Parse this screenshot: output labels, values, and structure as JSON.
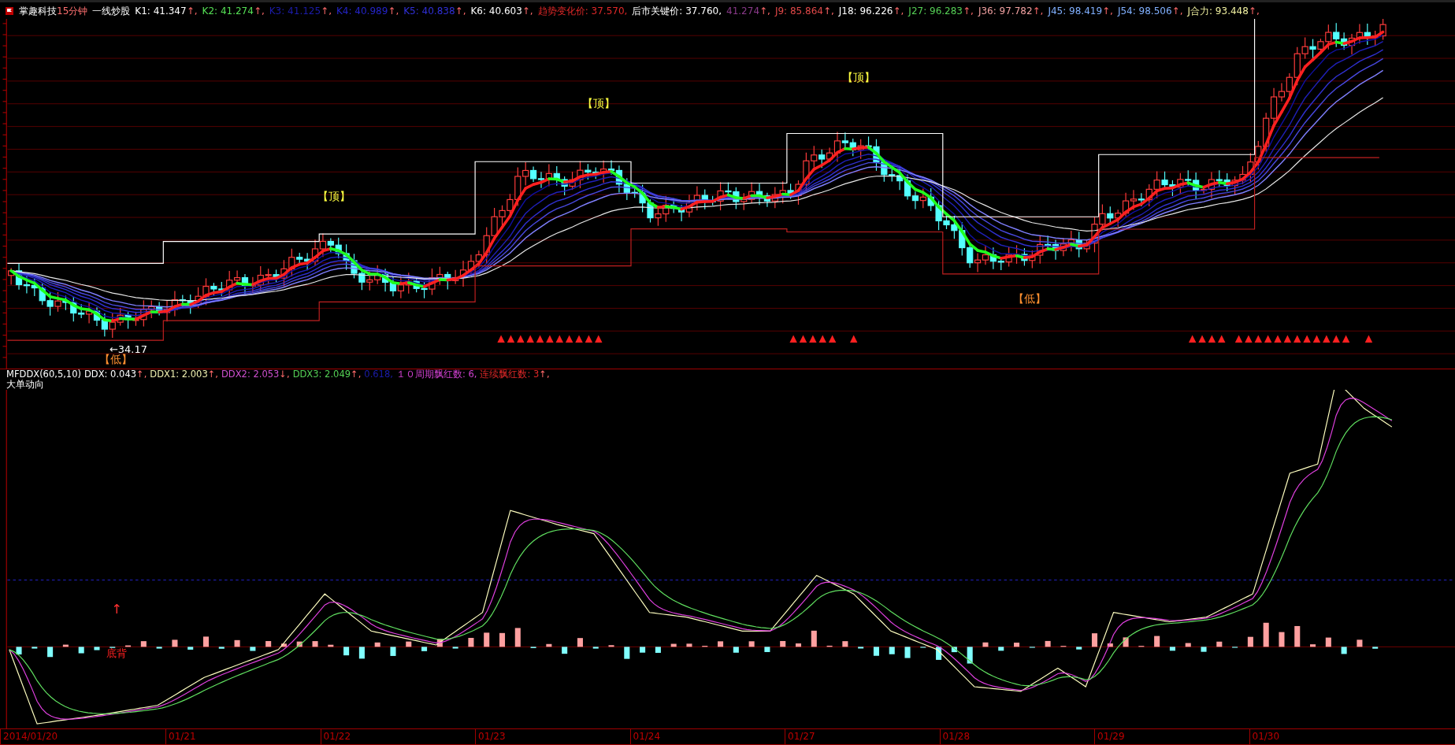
{
  "header": {
    "stock_name": "掌趣科技",
    "period": "15分钟",
    "indicator_name": "一线炒股",
    "readings": [
      {
        "text": "K1: 41.347",
        "arrow": "↑,",
        "color": "#ffffff"
      },
      {
        "text": "K2: 41.274",
        "arrow": "↑,",
        "color": "#55e055"
      },
      {
        "text": "K3: 41.125",
        "arrow": "↑,",
        "color": "#1c1caa"
      },
      {
        "text": "K4: 40.989",
        "arrow": "↑,",
        "color": "#2424c8"
      },
      {
        "text": "K5: 40.838",
        "arrow": "↑,",
        "color": "#3030d8"
      },
      {
        "text": "K6: 40.603",
        "arrow": "↑,",
        "color": "#ffffff"
      },
      {
        "text": "趋势变化价: 37.570,",
        "color": "#e02828"
      },
      {
        "text": "后市关键价: 37.760,",
        "color": "#ffffff"
      },
      {
        "text": "41.274",
        "arrow": "↑,",
        "color": "#8a3a8a"
      },
      {
        "text": "J9: 85.864",
        "arrow": "↑,",
        "color": "#e04848"
      },
      {
        "text": "J18: 96.226",
        "arrow": "↑,",
        "color": "#ffffff"
      },
      {
        "text": "J27: 96.283",
        "arrow": "↑,",
        "color": "#55d055"
      },
      {
        "text": "J36: 97.782",
        "arrow": "↑,",
        "color": "#f0a0a0"
      },
      {
        "text": "J45: 98.419",
        "arrow": "↑,",
        "color": "#80b0ff"
      },
      {
        "text": "J54: 98.506",
        "arrow": "↑,",
        "color": "#80b0ff"
      },
      {
        "text": "J合力: 93.448",
        "arrow": "↑,",
        "color": "#f0f0a0"
      }
    ]
  },
  "main_chart": {
    "signals": [
      {
        "kind": "top",
        "text": "【顶】"
      },
      {
        "kind": "top",
        "text": "【顶】"
      },
      {
        "kind": "top",
        "text": "【顶】"
      },
      {
        "kind": "bottom",
        "text": "【低】"
      },
      {
        "kind": "bottom",
        "text": "【低】"
      }
    ],
    "low_marker": "←34.17"
  },
  "indicator": {
    "name": "MFDDX(60,5,10)",
    "readings": [
      {
        "text": "DDX: 0.043",
        "arrow": "↑,",
        "color": "#ffffff"
      },
      {
        "text": "DDX1: 2.003",
        "arrow": "↑,",
        "color": "#f0f0b0"
      },
      {
        "text": "DDX2: 2.053",
        "arrow": "↓,",
        "color": "#d050d0"
      },
      {
        "text": "DDX3: 2.049",
        "arrow": "↑,",
        "color": "#55d055"
      },
      {
        "text": "0.618,",
        "color": "#1c1caa"
      },
      {
        "text": "１０周期飘红数: 6,",
        "color": "#d040d0"
      },
      {
        "text": "连续飘红数: 3",
        "arrow": "↑,",
        "color": "#e02828"
      }
    ],
    "title": "大单动向",
    "annotations": [
      {
        "kind": "arrow",
        "text": "↑"
      },
      {
        "kind": "label",
        "text": "底背"
      }
    ]
  },
  "time_axis": {
    "labels": [
      "2014/01/20",
      "01/21",
      "01/22",
      "01/23",
      "01/24",
      "01/27",
      "01/28",
      "01/29",
      "01/30"
    ]
  }
}
